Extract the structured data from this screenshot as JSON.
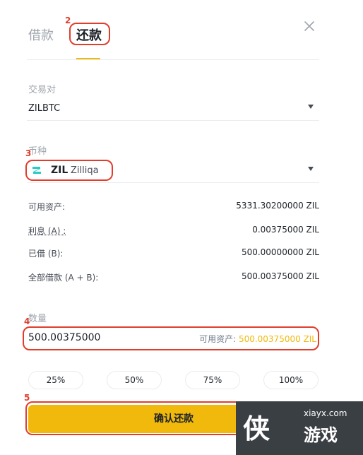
{
  "tabs": {
    "borrow": "借款",
    "repay": "还款"
  },
  "annotations": [
    "2",
    "3",
    "4",
    "5"
  ],
  "pair": {
    "label": "交易对",
    "value": "ZILBTC"
  },
  "coin": {
    "label": "币种",
    "symbol": "ZIL",
    "name": "Zilliqa"
  },
  "info": [
    {
      "label": "可用资产:",
      "value": "5331.30200000 ZIL"
    },
    {
      "label": "利息 (A) :",
      "value": "0.00375000 ZIL"
    },
    {
      "label": "已借 (B):",
      "value": "500.00000000 ZIL"
    },
    {
      "label": "全部借款 (A + B):",
      "value": "500.00375000 ZIL"
    }
  ],
  "amount": {
    "label": "数量",
    "value": "500.00375000",
    "available_label": "可用资产:",
    "available_value": "500.00375000 ZIL"
  },
  "percent_buttons": [
    "25%",
    "50%",
    "75%",
    "100%"
  ],
  "confirm_label": "确认还款",
  "watermark": {
    "logo": "侠",
    "url": "xiayx.com",
    "name": "游戏"
  },
  "colors": {
    "accent": "#f0b90b",
    "annotation": "#e03e2d",
    "text": "#1e2329"
  }
}
